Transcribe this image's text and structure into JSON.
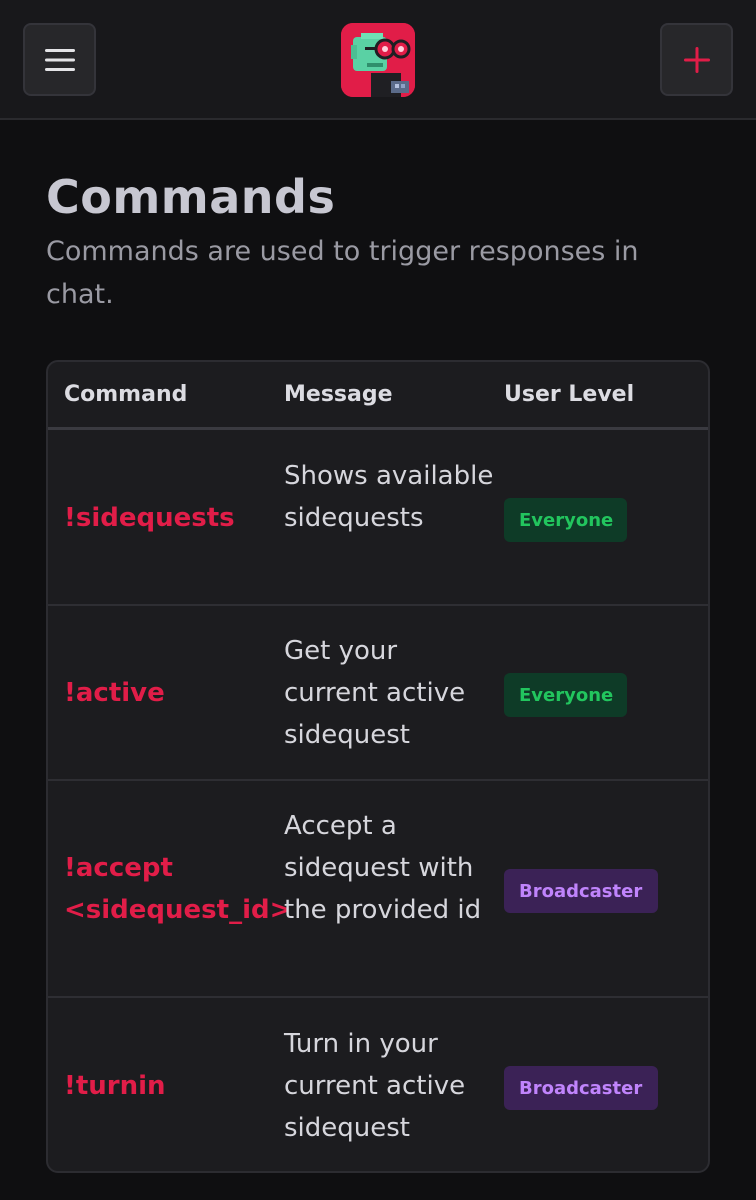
{
  "header": {
    "menu_icon": "hamburger-menu-icon",
    "logo_icon": "pixel-avatar-logo",
    "add_icon": "plus-icon",
    "accent": "#e11d48"
  },
  "page": {
    "title": "Commands",
    "subtitle": "Commands are used to trigger responses in chat."
  },
  "table": {
    "columns": [
      "Command",
      "Message",
      "User Level"
    ],
    "rows": [
      {
        "command": "!sidequests",
        "message": "Shows available sidequests",
        "level": "Everyone",
        "level_color": "#22c55e"
      },
      {
        "command": "!active",
        "message": "Get your current active sidequest",
        "level": "Everyone",
        "level_color": "#22c55e"
      },
      {
        "command": "!accept\n<sidequest_id>",
        "message": "Accept a sidequest with the provided id",
        "level": "Broadcaster",
        "level_color": "#c084fc"
      },
      {
        "command": "!turnin",
        "message": "Turn in your current active sidequest",
        "level": "Broadcaster",
        "level_color": "#c084fc"
      }
    ]
  }
}
